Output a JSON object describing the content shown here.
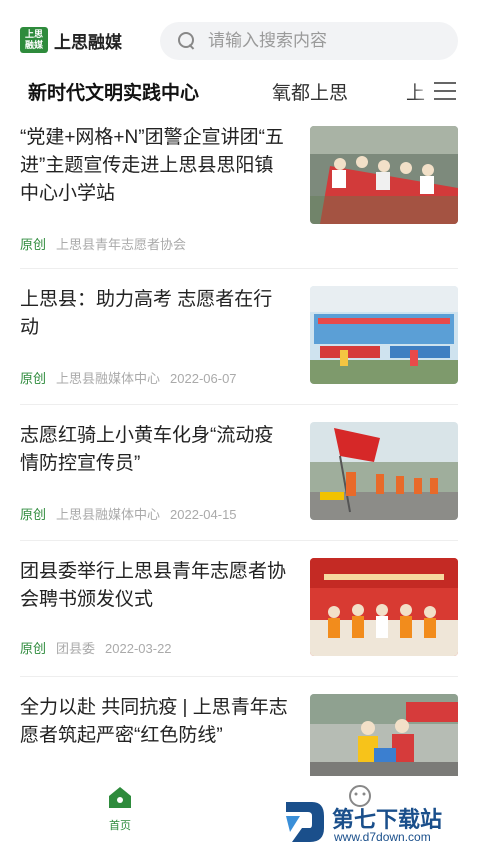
{
  "header": {
    "logo_badge": "上思融媒",
    "logo_text": "上思融媒",
    "search_placeholder": "请输入搜索内容"
  },
  "tabs": [
    {
      "label": "新时代文明实践中心",
      "active": true
    },
    {
      "label": "氧都上思",
      "active": false
    },
    {
      "label": "上",
      "active": false
    }
  ],
  "articles": [
    {
      "title": "“党建+网格+N”团警企宣讲团“五进”主题宣传走进上思县思阳镇中心小学站",
      "tag": "原创",
      "source": "上思县青年志愿者协会",
      "date": ""
    },
    {
      "title": "上思县：助力高考 志愿者在行动",
      "tag": "原创",
      "source": "上思县融媒体中心",
      "date": "2022-06-07"
    },
    {
      "title": "志愿红骑上小黄车化身“流动疫情防控宣传员”",
      "tag": "原创",
      "source": "上思县融媒体中心",
      "date": "2022-04-15"
    },
    {
      "title": "团县委举行上思县青年志愿者协会聘书颁发仪式",
      "tag": "原创",
      "source": "团县委",
      "date": "2022-03-22"
    },
    {
      "title": "全力以赴 共同抗疫 | 上思青年志愿者筑起严密“红色防线”",
      "tag": "",
      "source": "",
      "date": ""
    }
  ],
  "bottom_nav": {
    "home_label": "首页"
  },
  "watermark": {
    "text": "第七下载站",
    "url": "www.d7down.com"
  },
  "colors": {
    "brand_green": "#2e8b3c",
    "meta_gray": "#aaaaaa"
  }
}
